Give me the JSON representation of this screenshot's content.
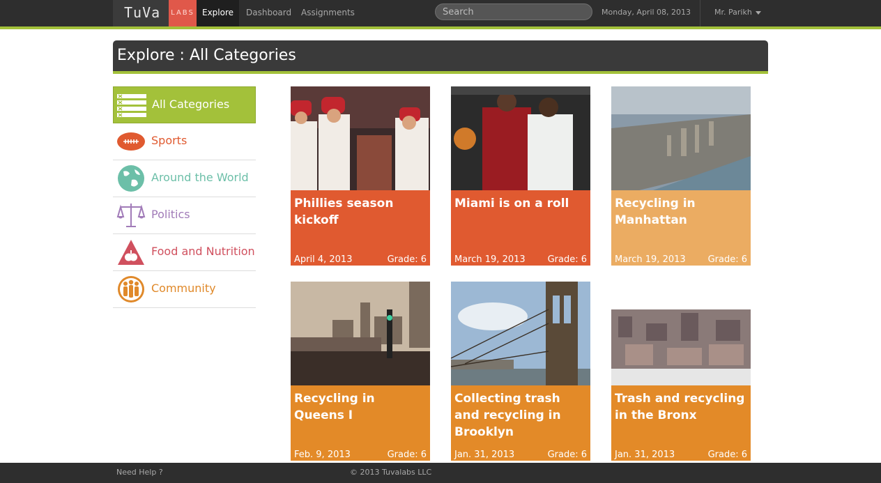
{
  "nav": {
    "brand": "TuVa",
    "labs": "LABS",
    "explore": "Explore",
    "dashboard": "Dashboard",
    "assignments": "Assignments",
    "search_placeholder": "Search",
    "date": "Monday, April 08, 2013",
    "user": "Mr. Parikh"
  },
  "page": {
    "title": "Explore : All Categories"
  },
  "sidebar": {
    "items": [
      {
        "label": "All Categories",
        "icon": "list-icon",
        "color": "#ffffff"
      },
      {
        "label": "Sports",
        "icon": "football-icon",
        "color": "#e05a30"
      },
      {
        "label": "Around the World",
        "icon": "globe-icon",
        "color": "#6cbfa8"
      },
      {
        "label": "Politics",
        "icon": "scales-icon",
        "color": "#a17bb8"
      },
      {
        "label": "Food and Nutrition",
        "icon": "apple-triangle-icon",
        "color": "#d0505e"
      },
      {
        "label": "Community",
        "icon": "people-icon",
        "color": "#e0892a"
      }
    ]
  },
  "cards": [
    {
      "title": "Phillies season kickoff",
      "date": "April 4, 2013",
      "grade": "Grade: 6",
      "color": "#e05a30"
    },
    {
      "title": "Miami is on a roll",
      "date": "March 19, 2013",
      "grade": "Grade: 6",
      "color": "#e05a30"
    },
    {
      "title": "Recycling in Manhattan",
      "date": "March 19, 2013",
      "grade": "Grade: 6",
      "color": "#ebac62"
    },
    {
      "title": "Recycling in Queens I",
      "date": "Feb. 9, 2013",
      "grade": "Grade: 6",
      "color": "#e38a28"
    },
    {
      "title": "Collecting trash and recycling in Brooklyn",
      "date": "Jan. 31, 2013",
      "grade": "Grade: 6",
      "color": "#e38a28"
    },
    {
      "title": "Trash and recycling in the Bronx",
      "date": "Jan. 31, 2013",
      "grade": "Grade: 6",
      "color": "#e38a28"
    }
  ],
  "footer": {
    "help": "Need Help ?",
    "copyright": "© 2013 Tuvalabs LLC"
  },
  "colors": {
    "accent": "#a3c13a",
    "labs": "#e0584a",
    "dark": "#2e2e2e"
  }
}
